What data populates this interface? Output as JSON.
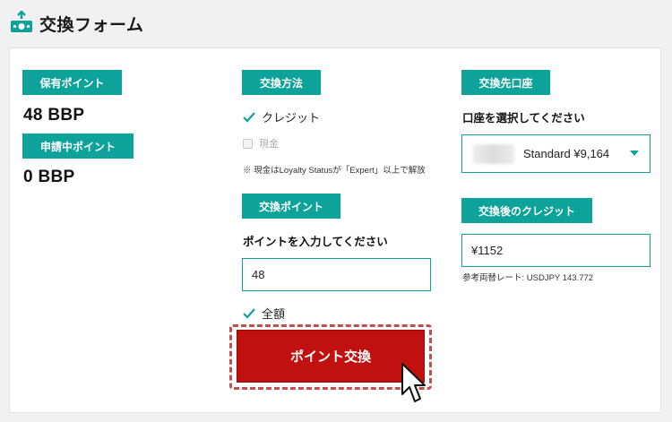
{
  "header": {
    "title": "交換フォーム",
    "logo_icon": "exchange-money-icon"
  },
  "colors": {
    "accent": "#0ea39a",
    "button": "#c0100f",
    "frame": "#c0504d"
  },
  "points": {
    "held_label": "保有ポイント",
    "held_value": "48 BBP",
    "pending_label": "申請中ポイント",
    "pending_value": "0 BBP"
  },
  "method": {
    "label": "交換方法",
    "credit_option": "クレジット",
    "cash_option": "現金",
    "note": "※ 現金はLoyalty Statusが「Expert」以上で解放"
  },
  "exchange_points": {
    "label": "交換ポイント",
    "prompt": "ポイントを入力してください",
    "value": "48",
    "all_label": "全額",
    "button_label": "ポイント交換"
  },
  "destination": {
    "label": "交換先口座",
    "prompt": "口座を選択してください",
    "selected_value": "Standard ¥9,164"
  },
  "after_credit": {
    "label": "交換後のクレジット",
    "value": "¥1152",
    "rate_note": "参考両替レート: USDJPY 143.772"
  }
}
